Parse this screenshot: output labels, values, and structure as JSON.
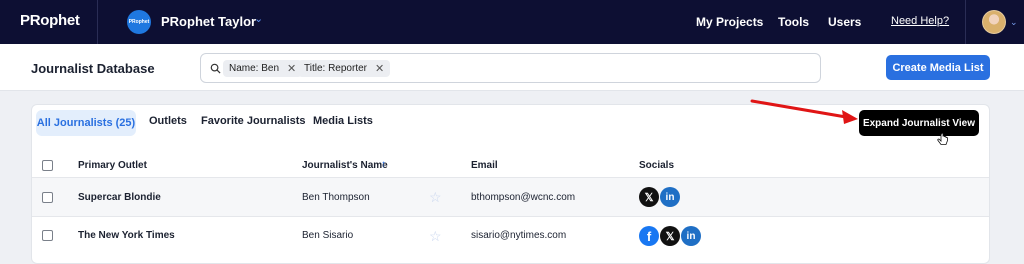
{
  "topbar": {
    "logo": "PRophet",
    "workspace_badge": "PRophet",
    "workspace_name": "PRophet Taylor",
    "nav": [
      "My Projects",
      "Tools",
      "Users"
    ],
    "help": "Need Help?"
  },
  "header": {
    "title": "Journalist Database",
    "filters": [
      {
        "label": "Name: Ben"
      },
      {
        "label": "Title: Reporter"
      }
    ],
    "create_button": "Create Media List"
  },
  "tabs": [
    "All Journalists (25)",
    "Outlets",
    "Favorite Journalists",
    "Media Lists"
  ],
  "expand_button": "Expand Journalist View",
  "table": {
    "columns": [
      "Primary Outlet",
      "Journalist's Name",
      "Email",
      "Socials"
    ],
    "rows": [
      {
        "outlet": "Supercar Blondie",
        "name": "Ben Thompson",
        "email": "bthompson@wcnc.com",
        "socials": [
          "x",
          "linkedin"
        ]
      },
      {
        "outlet": "The New York Times",
        "name": "Ben Sisario",
        "email": "sisario@nytimes.com",
        "socials": [
          "facebook",
          "x",
          "linkedin"
        ]
      }
    ]
  },
  "colors": {
    "topbar": "#0d0f33",
    "accent": "#2a70e0",
    "annotation_arrow": "#e01515"
  },
  "icons": [
    "search-icon",
    "close-icon",
    "chevron-down-icon",
    "sort-up-icon",
    "star-icon",
    "x-icon",
    "linkedin-icon",
    "facebook-icon",
    "cursor-hand-icon"
  ]
}
